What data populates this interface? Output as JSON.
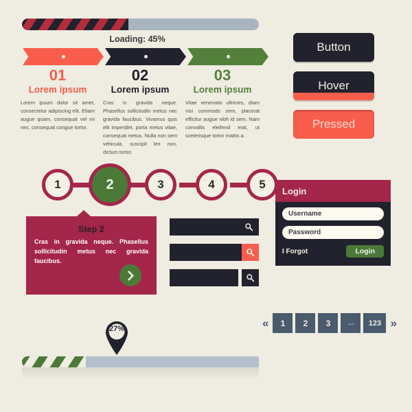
{
  "theme": {
    "background": "#efece1",
    "dark": "#22222e",
    "crimson": "#a4264a",
    "coral": "#f95e4d",
    "green": "#4b7a38",
    "slate": "#4a5b6e",
    "steel": "#a8b4c0"
  },
  "loader": {
    "label": "Loading: 45%",
    "percent": 45
  },
  "ribbons": [
    {
      "dot": "step-dot",
      "color": "#f95e4d"
    },
    {
      "dot": "step-dot",
      "color": "#22222e"
    },
    {
      "dot": "step-dot",
      "color": "#53813c"
    }
  ],
  "columns": [
    {
      "number": "01",
      "subtitle": "Lorem ipsum",
      "body": "Lorem ipsum dolor sit amet, consectetur adipiscing elit. Etiam augue quam, consequat vel mi nec, consequat congue tortor."
    },
    {
      "number": "02",
      "subtitle": "Lorem ipsum",
      "body": "Cras in gravida neque. Phasellus sollicitudin metus nec gravida faucibus. Vivamus quis elit imperdiet, porta metus vitae, consequat metus. Nulla non sem vehicula, suscipit leo non, dictum tortor."
    },
    {
      "number": "03",
      "subtitle": "Lorem ipsum",
      "body": "Vitae venenatis ultricies, diam nisi commodo sem, placerat efficitur augue nibh id sem. Nam convallis eleifend erat, ut scelerisque tortor mattis a."
    }
  ],
  "buttons": {
    "normal": "Button",
    "hover": "Hover",
    "pressed": "Pressed"
  },
  "steps": {
    "items": [
      "1",
      "2",
      "3",
      "4",
      "5"
    ],
    "active_index": 1
  },
  "step_panel": {
    "title": "Step 2",
    "body": "Cras in gravida neque. Phasellus sollicitudin metus nec gravida faucibus.",
    "next_icon": "chevron-right-icon"
  },
  "search_bars": [
    {
      "variant": "inline",
      "icon": "search-icon"
    },
    {
      "variant": "red-button",
      "icon": "search-icon"
    },
    {
      "variant": "dark-button",
      "icon": "search-icon"
    }
  ],
  "login": {
    "title": "Login",
    "username_placeholder": "Username",
    "password_placeholder": "Password",
    "forgot_label": "I Forgot",
    "submit_label": "Login"
  },
  "pagination": {
    "prev_icon": "double-chevron-left-icon",
    "next_icon": "double-chevron-right-icon",
    "pages": [
      "1",
      "2",
      "3",
      "…",
      "123"
    ]
  },
  "progress_marker": {
    "value": "27%",
    "percent": 27
  }
}
